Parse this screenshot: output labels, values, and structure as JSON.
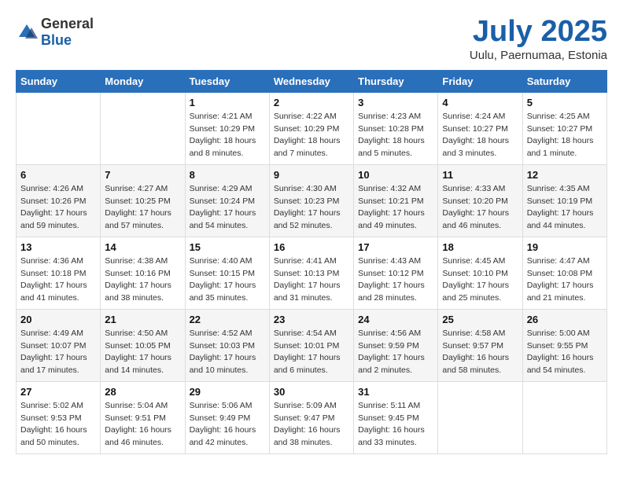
{
  "logo": {
    "general": "General",
    "blue": "Blue"
  },
  "header": {
    "month": "July 2025",
    "location": "Uulu, Paernumaa, Estonia"
  },
  "weekdays": [
    "Sunday",
    "Monday",
    "Tuesday",
    "Wednesday",
    "Thursday",
    "Friday",
    "Saturday"
  ],
  "weeks": [
    [
      {
        "day": "",
        "info": ""
      },
      {
        "day": "",
        "info": ""
      },
      {
        "day": "1",
        "info": "Sunrise: 4:21 AM\nSunset: 10:29 PM\nDaylight: 18 hours\nand 8 minutes."
      },
      {
        "day": "2",
        "info": "Sunrise: 4:22 AM\nSunset: 10:29 PM\nDaylight: 18 hours\nand 7 minutes."
      },
      {
        "day": "3",
        "info": "Sunrise: 4:23 AM\nSunset: 10:28 PM\nDaylight: 18 hours\nand 5 minutes."
      },
      {
        "day": "4",
        "info": "Sunrise: 4:24 AM\nSunset: 10:27 PM\nDaylight: 18 hours\nand 3 minutes."
      },
      {
        "day": "5",
        "info": "Sunrise: 4:25 AM\nSunset: 10:27 PM\nDaylight: 18 hours\nand 1 minute."
      }
    ],
    [
      {
        "day": "6",
        "info": "Sunrise: 4:26 AM\nSunset: 10:26 PM\nDaylight: 17 hours\nand 59 minutes."
      },
      {
        "day": "7",
        "info": "Sunrise: 4:27 AM\nSunset: 10:25 PM\nDaylight: 17 hours\nand 57 minutes."
      },
      {
        "day": "8",
        "info": "Sunrise: 4:29 AM\nSunset: 10:24 PM\nDaylight: 17 hours\nand 54 minutes."
      },
      {
        "day": "9",
        "info": "Sunrise: 4:30 AM\nSunset: 10:23 PM\nDaylight: 17 hours\nand 52 minutes."
      },
      {
        "day": "10",
        "info": "Sunrise: 4:32 AM\nSunset: 10:21 PM\nDaylight: 17 hours\nand 49 minutes."
      },
      {
        "day": "11",
        "info": "Sunrise: 4:33 AM\nSunset: 10:20 PM\nDaylight: 17 hours\nand 46 minutes."
      },
      {
        "day": "12",
        "info": "Sunrise: 4:35 AM\nSunset: 10:19 PM\nDaylight: 17 hours\nand 44 minutes."
      }
    ],
    [
      {
        "day": "13",
        "info": "Sunrise: 4:36 AM\nSunset: 10:18 PM\nDaylight: 17 hours\nand 41 minutes."
      },
      {
        "day": "14",
        "info": "Sunrise: 4:38 AM\nSunset: 10:16 PM\nDaylight: 17 hours\nand 38 minutes."
      },
      {
        "day": "15",
        "info": "Sunrise: 4:40 AM\nSunset: 10:15 PM\nDaylight: 17 hours\nand 35 minutes."
      },
      {
        "day": "16",
        "info": "Sunrise: 4:41 AM\nSunset: 10:13 PM\nDaylight: 17 hours\nand 31 minutes."
      },
      {
        "day": "17",
        "info": "Sunrise: 4:43 AM\nSunset: 10:12 PM\nDaylight: 17 hours\nand 28 minutes."
      },
      {
        "day": "18",
        "info": "Sunrise: 4:45 AM\nSunset: 10:10 PM\nDaylight: 17 hours\nand 25 minutes."
      },
      {
        "day": "19",
        "info": "Sunrise: 4:47 AM\nSunset: 10:08 PM\nDaylight: 17 hours\nand 21 minutes."
      }
    ],
    [
      {
        "day": "20",
        "info": "Sunrise: 4:49 AM\nSunset: 10:07 PM\nDaylight: 17 hours\nand 17 minutes."
      },
      {
        "day": "21",
        "info": "Sunrise: 4:50 AM\nSunset: 10:05 PM\nDaylight: 17 hours\nand 14 minutes."
      },
      {
        "day": "22",
        "info": "Sunrise: 4:52 AM\nSunset: 10:03 PM\nDaylight: 17 hours\nand 10 minutes."
      },
      {
        "day": "23",
        "info": "Sunrise: 4:54 AM\nSunset: 10:01 PM\nDaylight: 17 hours\nand 6 minutes."
      },
      {
        "day": "24",
        "info": "Sunrise: 4:56 AM\nSunset: 9:59 PM\nDaylight: 17 hours\nand 2 minutes."
      },
      {
        "day": "25",
        "info": "Sunrise: 4:58 AM\nSunset: 9:57 PM\nDaylight: 16 hours\nand 58 minutes."
      },
      {
        "day": "26",
        "info": "Sunrise: 5:00 AM\nSunset: 9:55 PM\nDaylight: 16 hours\nand 54 minutes."
      }
    ],
    [
      {
        "day": "27",
        "info": "Sunrise: 5:02 AM\nSunset: 9:53 PM\nDaylight: 16 hours\nand 50 minutes."
      },
      {
        "day": "28",
        "info": "Sunrise: 5:04 AM\nSunset: 9:51 PM\nDaylight: 16 hours\nand 46 minutes."
      },
      {
        "day": "29",
        "info": "Sunrise: 5:06 AM\nSunset: 9:49 PM\nDaylight: 16 hours\nand 42 minutes."
      },
      {
        "day": "30",
        "info": "Sunrise: 5:09 AM\nSunset: 9:47 PM\nDaylight: 16 hours\nand 38 minutes."
      },
      {
        "day": "31",
        "info": "Sunrise: 5:11 AM\nSunset: 9:45 PM\nDaylight: 16 hours\nand 33 minutes."
      },
      {
        "day": "",
        "info": ""
      },
      {
        "day": "",
        "info": ""
      }
    ]
  ]
}
